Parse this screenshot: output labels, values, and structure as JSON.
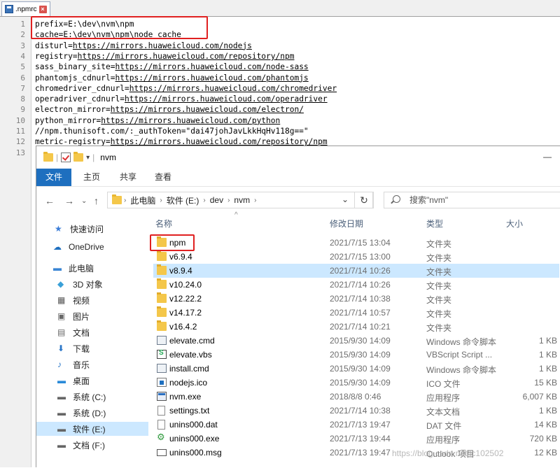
{
  "editor": {
    "tab_label": ".npmrc",
    "lines": [
      {
        "num": "1",
        "text": "prefix=E:\\dev\\nvm\\npm",
        "key": "prefix=E:\\dev\\nvm\\npm",
        "url": ""
      },
      {
        "num": "2",
        "text": "cache=E:\\dev\\nvm\\npm\\node_cache",
        "key": "cache=E:\\dev\\nvm\\npm\\node_cache",
        "url": ""
      },
      {
        "num": "3",
        "key": "disturl=",
        "url": "https://mirrors.huaweicloud.com/nodejs"
      },
      {
        "num": "4",
        "key": "registry=",
        "url": "https://mirrors.huaweicloud.com/repository/npm"
      },
      {
        "num": "5",
        "key": "sass_binary_site=",
        "url": "https://mirrors.huaweicloud.com/node-sass"
      },
      {
        "num": "6",
        "key": "phantomjs_cdnurl=",
        "url": "https://mirrors.huaweicloud.com/phantomjs"
      },
      {
        "num": "7",
        "key": "chromedriver_cdnurl=",
        "url": "https://mirrors.huaweicloud.com/chromedriver"
      },
      {
        "num": "8",
        "key": "operadriver_cdnurl=",
        "url": "https://mirrors.huaweicloud.com/operadriver"
      },
      {
        "num": "9",
        "key": "electron_mirror=",
        "url": "https://mirrors.huaweicloud.com/electron/"
      },
      {
        "num": "10",
        "key": "python_mirror=",
        "url": "https://mirrors.huaweicloud.com/python"
      },
      {
        "num": "11",
        "key": "//npm.thunisoft.com/:_authToken=\"dai47johJavLkkHqHv118g==\"",
        "url": ""
      },
      {
        "num": "12",
        "key": "metric-registry=",
        "url": "https://mirrors.huaweicloud.com/repository/npm"
      },
      {
        "num": "13",
        "key": "",
        "url": ""
      }
    ]
  },
  "explorer": {
    "title": "nvm",
    "ribbon_tabs": [
      "文件",
      "主页",
      "共享",
      "查看"
    ],
    "breadcrumb": [
      "此电脑",
      "软件 (E:)",
      "dev",
      "nvm"
    ],
    "search_placeholder": "搜索\"nvm\"",
    "columns": {
      "name": "名称",
      "date": "修改日期",
      "type": "类型",
      "size": "大小"
    },
    "sidebar": [
      {
        "label": "快速访问",
        "icon": "star-icon"
      },
      {
        "label": "OneDrive",
        "icon": "cloud-icon"
      },
      {
        "label": "此电脑",
        "icon": "computer-icon"
      },
      {
        "label": "3D 对象",
        "icon": "cube-icon"
      },
      {
        "label": "视频",
        "icon": "video-icon"
      },
      {
        "label": "图片",
        "icon": "picture-icon"
      },
      {
        "label": "文档",
        "icon": "document-icon"
      },
      {
        "label": "下载",
        "icon": "download-icon"
      },
      {
        "label": "音乐",
        "icon": "music-icon"
      },
      {
        "label": "桌面",
        "icon": "desktop-icon"
      },
      {
        "label": "系统 (C:)",
        "icon": "drive-icon"
      },
      {
        "label": "系统 (D:)",
        "icon": "drive-icon"
      },
      {
        "label": "软件 (E:)",
        "icon": "drive-icon"
      },
      {
        "label": "文档 (F:)",
        "icon": "drive-icon"
      }
    ],
    "files": [
      {
        "name": "npm",
        "date": "2021/7/15 13:04",
        "type": "文件夹",
        "size": "",
        "icon": "folder"
      },
      {
        "name": "v6.9.4",
        "date": "2021/7/15 13:00",
        "type": "文件夹",
        "size": "",
        "icon": "folder"
      },
      {
        "name": "v8.9.4",
        "date": "2021/7/14 10:26",
        "type": "文件夹",
        "size": "",
        "icon": "folder"
      },
      {
        "name": "v10.24.0",
        "date": "2021/7/14 10:26",
        "type": "文件夹",
        "size": "",
        "icon": "folder"
      },
      {
        "name": "v12.22.2",
        "date": "2021/7/14 10:38",
        "type": "文件夹",
        "size": "",
        "icon": "folder"
      },
      {
        "name": "v14.17.2",
        "date": "2021/7/14 10:57",
        "type": "文件夹",
        "size": "",
        "icon": "folder"
      },
      {
        "name": "v16.4.2",
        "date": "2021/7/14 10:21",
        "type": "文件夹",
        "size": "",
        "icon": "folder"
      },
      {
        "name": "elevate.cmd",
        "date": "2015/9/30 14:09",
        "type": "Windows 命令脚本",
        "size": "1 KB",
        "icon": "cmd"
      },
      {
        "name": "elevate.vbs",
        "date": "2015/9/30 14:09",
        "type": "VBScript Script ...",
        "size": "1 KB",
        "icon": "vbs"
      },
      {
        "name": "install.cmd",
        "date": "2015/9/30 14:09",
        "type": "Windows 命令脚本",
        "size": "1 KB",
        "icon": "cmd"
      },
      {
        "name": "nodejs.ico",
        "date": "2015/9/30 14:09",
        "type": "ICO 文件",
        "size": "15 KB",
        "icon": "ico"
      },
      {
        "name": "nvm.exe",
        "date": "2018/8/8 0:46",
        "type": "应用程序",
        "size": "6,007 KB",
        "icon": "exe"
      },
      {
        "name": "settings.txt",
        "date": "2021/7/14 10:38",
        "type": "文本文档",
        "size": "1 KB",
        "icon": "file"
      },
      {
        "name": "unins000.dat",
        "date": "2021/7/13 19:47",
        "type": "DAT 文件",
        "size": "14 KB",
        "icon": "file"
      },
      {
        "name": "unins000.exe",
        "date": "2021/7/13 19:44",
        "type": "应用程序",
        "size": "720 KB",
        "icon": "gear"
      },
      {
        "name": "unins000.msg",
        "date": "2021/7/13 19:47",
        "type": "Outlook 项目",
        "size": "12 KB",
        "icon": "msg"
      }
    ]
  },
  "watermark": "https://blog.csdn.net/lc102502"
}
